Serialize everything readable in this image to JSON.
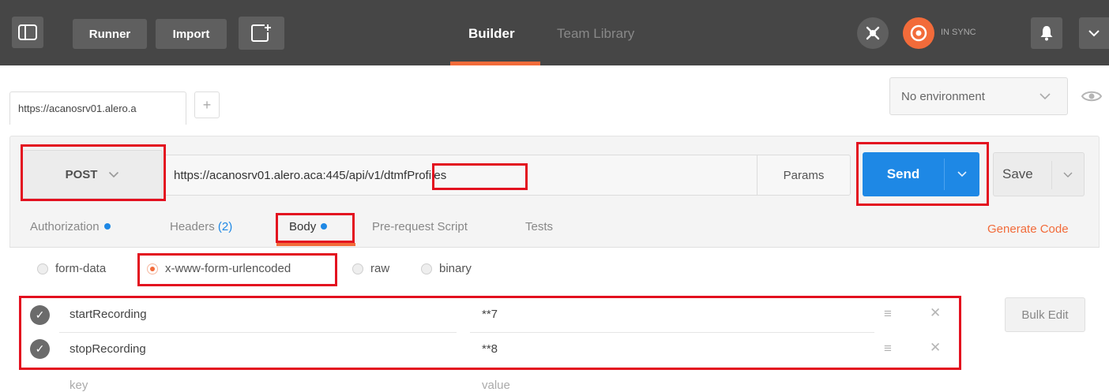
{
  "topbar": {
    "runner_label": "Runner",
    "import_label": "Import",
    "builder_label": "Builder",
    "team_library_label": "Team Library",
    "sync_status": "IN SYNC"
  },
  "tabs": {
    "active_tab_label": "https://acanosrv01.alero.a",
    "add_tab_label": "+"
  },
  "environment": {
    "selected": "No environment"
  },
  "request": {
    "method": "POST",
    "url_prefix": "https://acanosrv01.alero.aca:445/api/v1/",
    "url_endpoint": "dtmfProfiles",
    "params_label": "Params",
    "send_label": "Send",
    "save_label": "Save"
  },
  "subtabs": {
    "authorization": "Authorization",
    "headers": "Headers",
    "headers_count": "(2)",
    "body": "Body",
    "pre_request": "Pre-request Script",
    "tests": "Tests",
    "generate_code": "Generate Code"
  },
  "body_modes": {
    "form_data": "form-data",
    "urlencoded": "x-www-form-urlencoded",
    "raw": "raw",
    "binary": "binary",
    "selected": "x-www-form-urlencoded"
  },
  "params": [
    {
      "key": "startRecording",
      "value": "**7",
      "enabled": true
    },
    {
      "key": "stopRecording",
      "value": "**8",
      "enabled": true
    }
  ],
  "new_row": {
    "key_placeholder": "key",
    "value_placeholder": "value"
  },
  "bulk_edit_label": "Bulk Edit",
  "colors": {
    "accent_orange": "#f26b3a",
    "send_blue": "#1e88e5",
    "topbar_bg": "#464646",
    "highlight_red": "#e3101f"
  }
}
